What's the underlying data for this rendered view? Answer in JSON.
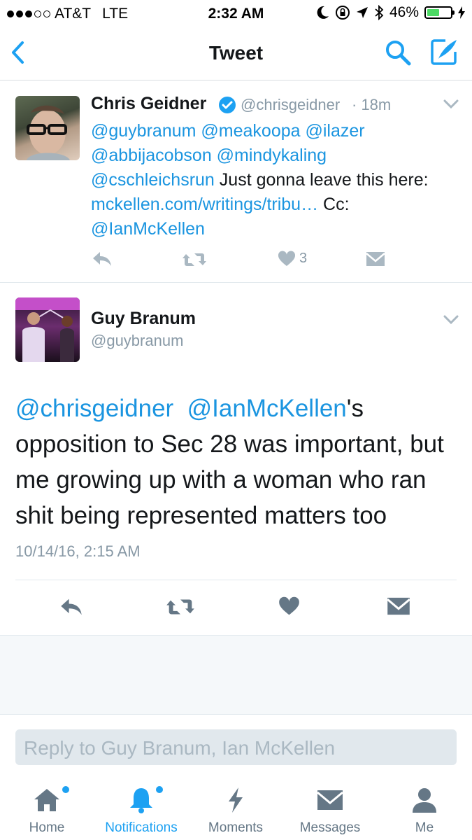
{
  "status_bar": {
    "carrier": "AT&T",
    "network": "LTE",
    "time": "2:32 AM",
    "battery_percent": "46%",
    "battery_level": 0.46
  },
  "nav": {
    "title": "Tweet",
    "back_icon": "chevron-left-icon",
    "search_icon": "search-icon",
    "compose_icon": "compose-icon"
  },
  "parent_tweet": {
    "name": "Chris Geidner",
    "handle": "@chrisgeidner",
    "time": "· 18m",
    "mentions": [
      "@guybranum",
      "@meakoopa",
      "@ilazer",
      "@abbijacobson",
      "@mindykaling",
      "@cschleichsrun"
    ],
    "text_part": " Just gonna leave this here: ",
    "link": "mckellen.com/writings/tribu…",
    "cc_text": " Cc: ",
    "cc_mention": "@IanMcKellen",
    "like_count": "3"
  },
  "main_tweet": {
    "name": "Guy Branum",
    "handle": "@guybranum",
    "mention1": "@chrisgeidner",
    "mention2": "@IanMcKellen",
    "text_suffix": "'s",
    "text_body": "opposition to Sec 28 was important, but me growing up with a woman who ran shit being represented matters too",
    "timestamp": "10/14/16, 2:15 AM"
  },
  "reply": {
    "placeholder": "Reply to Guy Branum, Ian McKellen"
  },
  "tabbar": {
    "tabs": [
      {
        "label": "Home",
        "icon": "home-icon",
        "badge": true,
        "active": false
      },
      {
        "label": "Notifications",
        "icon": "bell-icon",
        "badge": true,
        "active": true
      },
      {
        "label": "Moments",
        "icon": "lightning-icon",
        "badge": false,
        "active": false
      },
      {
        "label": "Messages",
        "icon": "envelope-icon",
        "badge": false,
        "active": false
      },
      {
        "label": "Me",
        "icon": "person-icon",
        "badge": false,
        "active": false
      }
    ]
  },
  "colors": {
    "accent": "#1da1f2",
    "link": "#1b95e0",
    "muted": "#8899a6",
    "verified": "#1da1f2"
  }
}
